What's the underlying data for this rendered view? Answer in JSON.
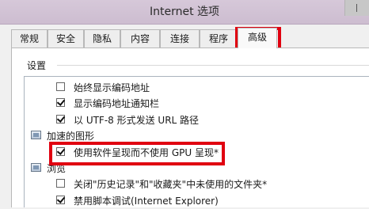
{
  "window": {
    "title": "Internet 选项"
  },
  "tabs": [
    {
      "label": "常规"
    },
    {
      "label": "安全"
    },
    {
      "label": "隐私"
    },
    {
      "label": "内容"
    },
    {
      "label": "连接"
    },
    {
      "label": "程序"
    },
    {
      "label": "高级",
      "selected": true
    }
  ],
  "settings": {
    "section_label": "设置",
    "items": [
      {
        "type": "checkbox",
        "label": "始终显示编码地址",
        "checked": false
      },
      {
        "type": "checkbox",
        "label": "显示编码地址通知栏",
        "checked": true
      },
      {
        "type": "checkbox",
        "label": "以 UTF-8 形式发送 URL 路径",
        "checked": true
      },
      {
        "type": "category",
        "label": "加速的图形",
        "icon": "settings-category-icon"
      },
      {
        "type": "checkbox",
        "label": "使用软件呈现而不使用 GPU 呈现*",
        "checked": true,
        "highlighted": true
      },
      {
        "type": "category",
        "label": "浏览",
        "icon": "settings-category-icon"
      },
      {
        "type": "checkbox",
        "label": "关闭\"历史记录\"和\"收藏夹\"中未使用的文件夹*",
        "checked": false
      },
      {
        "type": "checkbox",
        "label": "禁用脚本调试(Internet Explorer)",
        "checked": true
      }
    ]
  },
  "colors": {
    "highlight": "#e00010",
    "titlebar": "#cdbdd0"
  }
}
